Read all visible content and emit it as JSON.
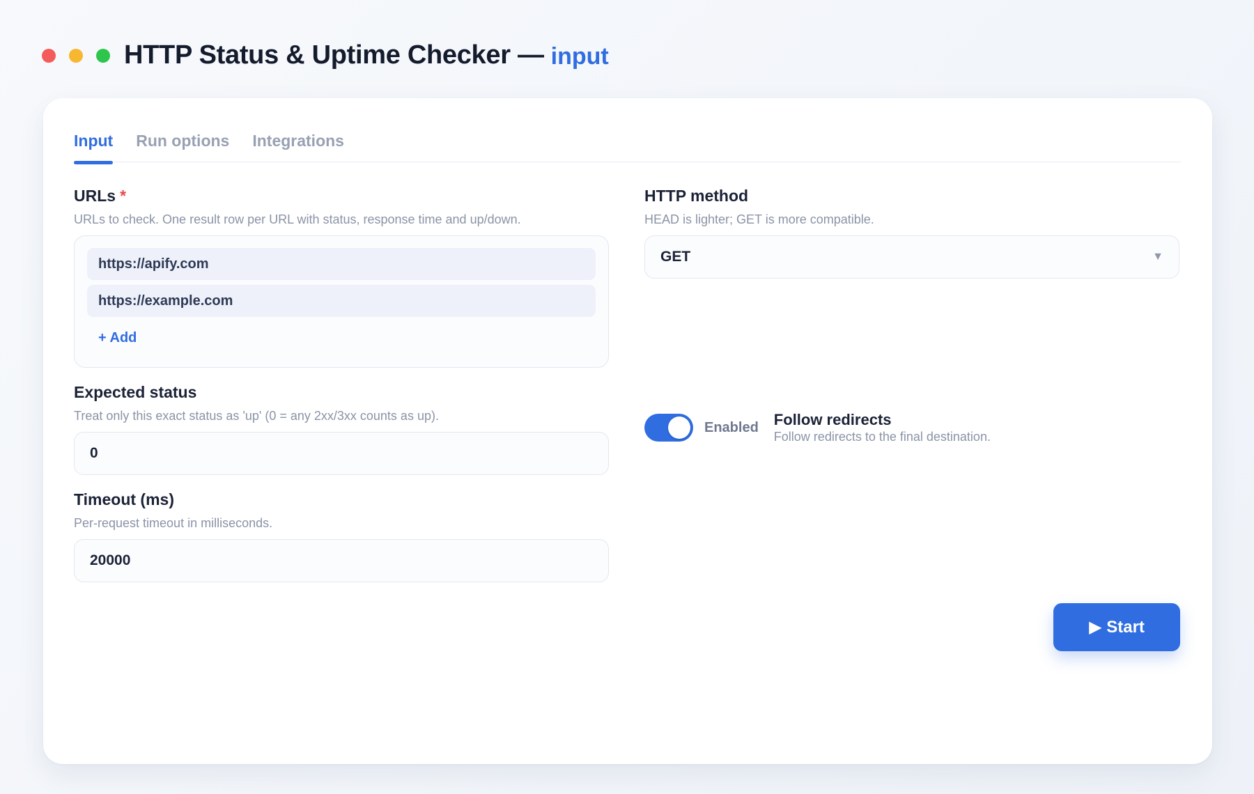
{
  "window": {
    "title": "HTTP Status & Uptime Checker —",
    "subtitle": "input",
    "controls": {
      "close_color": "#f45b5b",
      "minimize_color": "#f7b731",
      "maximize_color": "#2ec54d"
    }
  },
  "tabs": [
    {
      "label": "Input",
      "active": true
    },
    {
      "label": "Run options",
      "active": false
    },
    {
      "label": "Integrations",
      "active": false
    }
  ],
  "form": {
    "urls": {
      "label": "URLs",
      "required_mark": "*",
      "description": "URLs to check. One result row per URL with status, response time and up/down.",
      "items": [
        "https://apify.com",
        "https://example.com"
      ],
      "add_label": "+ Add"
    },
    "method": {
      "label": "HTTP method",
      "description": "HEAD is lighter; GET is more compatible.",
      "value": "GET",
      "caret": "▼"
    },
    "expected_status": {
      "label": "Expected status",
      "description": "Treat only this exact status as 'up' (0 = any 2xx/3xx counts as up).",
      "value": "0"
    },
    "follow_redirects": {
      "state_label": "Enabled",
      "enabled": true,
      "label": "Follow redirects",
      "description": "Follow redirects to the final destination."
    },
    "timeout": {
      "label": "Timeout (ms)",
      "description": "Per-request timeout in milliseconds.",
      "value": "20000"
    }
  },
  "actions": {
    "start_label": "▶ Start"
  },
  "colors": {
    "accent": "#2f6de1",
    "required": "#e5484d"
  }
}
